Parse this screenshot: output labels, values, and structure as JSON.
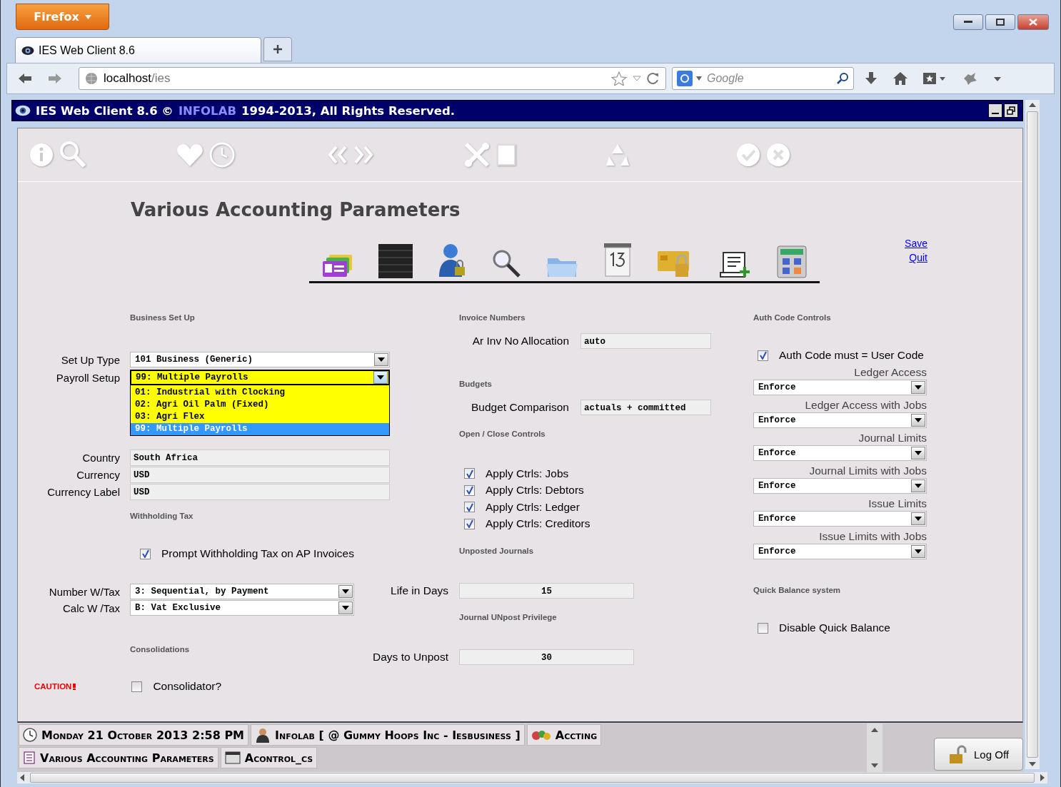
{
  "browser": {
    "menu_button": "Firefox",
    "tab_title": "IES Web Client 8.6",
    "url_host": "localhost",
    "url_path": "/ies",
    "search_placeholder": "Google"
  },
  "app_header": {
    "title": "IES Web Client 8.6 ©",
    "brand": "INFOLAB",
    "rights": "1994-2013, All Rights Reserved."
  },
  "page_title": "Various Accounting Parameters",
  "links": [
    "Save",
    "Quit"
  ],
  "business_setup": {
    "heading": "Business Set Up",
    "set_up_type": {
      "label": "Set Up Type",
      "value": "101 Business (Generic)"
    },
    "payroll_setup": {
      "label": "Payroll Setup",
      "value": "99: Multiple Payrolls",
      "expanded": true,
      "options": [
        {
          "label": "01: Industrial with Clocking",
          "selected": false
        },
        {
          "label": "02: Agri Oil Palm (Fixed)",
          "selected": false
        },
        {
          "label": "03: Agri Flex",
          "selected": false
        },
        {
          "label": "99: Multiple Payrolls",
          "selected": true
        }
      ]
    }
  },
  "location_fields": [
    {
      "label": "Country",
      "value": "South Africa"
    },
    {
      "label": "Currency",
      "value": "USD"
    },
    {
      "label": "Currency Label",
      "value": "USD"
    }
  ],
  "withholding_tax": {
    "heading": "Withholding Tax",
    "prompt": {
      "label": "Prompt Withholding Tax on AP Invoices",
      "checked": true
    },
    "selects": [
      {
        "label": "Number W/Tax",
        "value": "3: Sequential, by Payment"
      },
      {
        "label": "Calc W /Tax",
        "value": "B: Vat Exclusive"
      }
    ]
  },
  "consolidations": {
    "heading": "Consolidations",
    "caution": "CAUTION",
    "checkbox": {
      "label": "Consolidator?",
      "checked": false
    }
  },
  "invoice_numbers": {
    "heading": "Invoice Numbers",
    "field": {
      "label": "Ar Inv No Allocation",
      "value": "auto"
    }
  },
  "budgets": {
    "heading": "Budgets",
    "field": {
      "label": "Budget Comparison",
      "value": "actuals + committed"
    }
  },
  "open_close_controls": {
    "heading": "Open / Close Controls",
    "items": [
      {
        "label": "Apply Ctrls: Jobs",
        "checked": true
      },
      {
        "label": "Apply Ctrls: Debtors",
        "checked": true
      },
      {
        "label": "Apply Ctrls: Ledger",
        "checked": true
      },
      {
        "label": "Apply Ctrls: Creditors",
        "checked": true
      }
    ]
  },
  "unposted_journals": {
    "heading": "Unposted Journals",
    "field": {
      "label": "Life in Days",
      "value": "15"
    }
  },
  "journal_unpost_privilege": {
    "heading": "Journal UNpost Privilege",
    "field": {
      "label": "Days to Unpost",
      "value": "30"
    }
  },
  "auth_code_controls": {
    "heading": "Auth Code Controls",
    "checkbox": {
      "label": "Auth Code must = User Code",
      "checked": true
    },
    "selects": [
      {
        "label": "Ledger Access",
        "value": "Enforce"
      },
      {
        "label": "Ledger Access with Jobs",
        "value": "Enforce"
      },
      {
        "label": "Journal Limits",
        "value": "Enforce"
      },
      {
        "label": "Journal Limits with Jobs",
        "value": "Enforce"
      },
      {
        "label": "Issue Limits",
        "value": "Enforce"
      },
      {
        "label": "Issue Limits with Jobs",
        "value": "Enforce"
      }
    ]
  },
  "quick_balance": {
    "heading": "Quick Balance system",
    "checkbox": {
      "label": "Disable Quick Balance",
      "checked": false
    }
  },
  "taskbar": {
    "items": [
      {
        "kind": "clock",
        "label": "Monday 21 October 2013 2:58 PM"
      },
      {
        "kind": "user",
        "label": "Infolab [ @ Gummy Hoops Inc - Iesbusiness ]"
      },
      {
        "kind": "module",
        "label": "Accting"
      },
      {
        "kind": "document",
        "label": "Various Accounting Parameters"
      },
      {
        "kind": "form",
        "label": "Acontrol_cs"
      }
    ],
    "log_off": "Log Off"
  }
}
